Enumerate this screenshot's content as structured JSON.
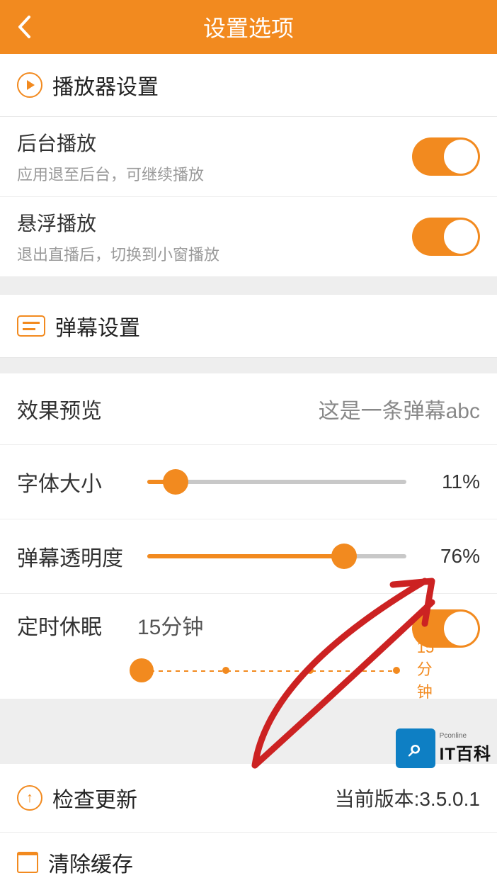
{
  "header": {
    "title": "设置选项"
  },
  "player": {
    "section_title": "播放器设置",
    "background_play": {
      "title": "后台播放",
      "sub": "应用退至后台，可继续播放",
      "on": true
    },
    "float_play": {
      "title": "悬浮播放",
      "sub": "退出直播后，切换到小窗播放",
      "on": true
    }
  },
  "danmu": {
    "section_title": "弹幕设置",
    "preview": {
      "label": "效果预览",
      "value": "这是一条弹幕abc"
    },
    "font_size": {
      "label": "字体大小",
      "percent": 11,
      "display": "11%"
    },
    "opacity": {
      "label": "弹幕透明度",
      "percent": 76,
      "display": "76%"
    },
    "sleep": {
      "label": "定时休眠",
      "value": "15分钟",
      "on": true,
      "end_label": "15分钟"
    }
  },
  "update": {
    "label": "检查更新",
    "version": "当前版本:3.5.0.1"
  },
  "clear": {
    "label": "清除缓存"
  },
  "watermark": {
    "small": "Pconline",
    "big": "IT百科"
  }
}
